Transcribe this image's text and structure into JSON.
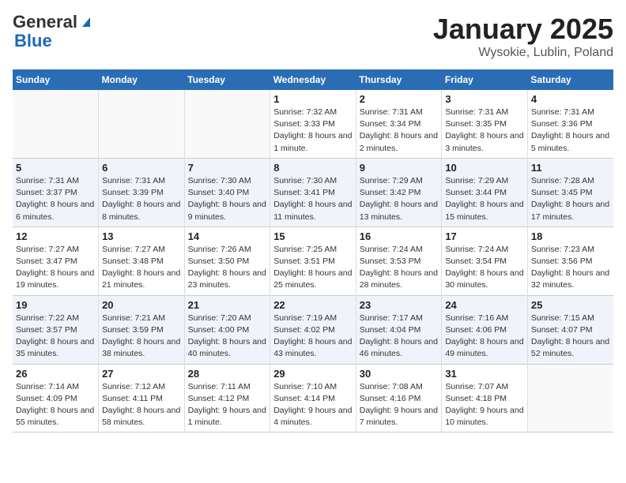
{
  "app": {
    "logo_general": "General",
    "logo_blue": "Blue",
    "title": "January 2025",
    "subtitle": "Wysokie, Lublin, Poland"
  },
  "calendar": {
    "headers": [
      "Sunday",
      "Monday",
      "Tuesday",
      "Wednesday",
      "Thursday",
      "Friday",
      "Saturday"
    ],
    "rows": [
      [
        {
          "day": "",
          "info": ""
        },
        {
          "day": "",
          "info": ""
        },
        {
          "day": "",
          "info": ""
        },
        {
          "day": "1",
          "info": "Sunrise: 7:32 AM\nSunset: 3:33 PM\nDaylight: 8 hours\nand 1 minute."
        },
        {
          "day": "2",
          "info": "Sunrise: 7:31 AM\nSunset: 3:34 PM\nDaylight: 8 hours\nand 2 minutes."
        },
        {
          "day": "3",
          "info": "Sunrise: 7:31 AM\nSunset: 3:35 PM\nDaylight: 8 hours\nand 3 minutes."
        },
        {
          "day": "4",
          "info": "Sunrise: 7:31 AM\nSunset: 3:36 PM\nDaylight: 8 hours\nand 5 minutes."
        }
      ],
      [
        {
          "day": "5",
          "info": "Sunrise: 7:31 AM\nSunset: 3:37 PM\nDaylight: 8 hours\nand 6 minutes."
        },
        {
          "day": "6",
          "info": "Sunrise: 7:31 AM\nSunset: 3:39 PM\nDaylight: 8 hours\nand 8 minutes."
        },
        {
          "day": "7",
          "info": "Sunrise: 7:30 AM\nSunset: 3:40 PM\nDaylight: 8 hours\nand 9 minutes."
        },
        {
          "day": "8",
          "info": "Sunrise: 7:30 AM\nSunset: 3:41 PM\nDaylight: 8 hours\nand 11 minutes."
        },
        {
          "day": "9",
          "info": "Sunrise: 7:29 AM\nSunset: 3:42 PM\nDaylight: 8 hours\nand 13 minutes."
        },
        {
          "day": "10",
          "info": "Sunrise: 7:29 AM\nSunset: 3:44 PM\nDaylight: 8 hours\nand 15 minutes."
        },
        {
          "day": "11",
          "info": "Sunrise: 7:28 AM\nSunset: 3:45 PM\nDaylight: 8 hours\nand 17 minutes."
        }
      ],
      [
        {
          "day": "12",
          "info": "Sunrise: 7:27 AM\nSunset: 3:47 PM\nDaylight: 8 hours\nand 19 minutes."
        },
        {
          "day": "13",
          "info": "Sunrise: 7:27 AM\nSunset: 3:48 PM\nDaylight: 8 hours\nand 21 minutes."
        },
        {
          "day": "14",
          "info": "Sunrise: 7:26 AM\nSunset: 3:50 PM\nDaylight: 8 hours\nand 23 minutes."
        },
        {
          "day": "15",
          "info": "Sunrise: 7:25 AM\nSunset: 3:51 PM\nDaylight: 8 hours\nand 25 minutes."
        },
        {
          "day": "16",
          "info": "Sunrise: 7:24 AM\nSunset: 3:53 PM\nDaylight: 8 hours\nand 28 minutes."
        },
        {
          "day": "17",
          "info": "Sunrise: 7:24 AM\nSunset: 3:54 PM\nDaylight: 8 hours\nand 30 minutes."
        },
        {
          "day": "18",
          "info": "Sunrise: 7:23 AM\nSunset: 3:56 PM\nDaylight: 8 hours\nand 32 minutes."
        }
      ],
      [
        {
          "day": "19",
          "info": "Sunrise: 7:22 AM\nSunset: 3:57 PM\nDaylight: 8 hours\nand 35 minutes."
        },
        {
          "day": "20",
          "info": "Sunrise: 7:21 AM\nSunset: 3:59 PM\nDaylight: 8 hours\nand 38 minutes."
        },
        {
          "day": "21",
          "info": "Sunrise: 7:20 AM\nSunset: 4:00 PM\nDaylight: 8 hours\nand 40 minutes."
        },
        {
          "day": "22",
          "info": "Sunrise: 7:19 AM\nSunset: 4:02 PM\nDaylight: 8 hours\nand 43 minutes."
        },
        {
          "day": "23",
          "info": "Sunrise: 7:17 AM\nSunset: 4:04 PM\nDaylight: 8 hours\nand 46 minutes."
        },
        {
          "day": "24",
          "info": "Sunrise: 7:16 AM\nSunset: 4:06 PM\nDaylight: 8 hours\nand 49 minutes."
        },
        {
          "day": "25",
          "info": "Sunrise: 7:15 AM\nSunset: 4:07 PM\nDaylight: 8 hours\nand 52 minutes."
        }
      ],
      [
        {
          "day": "26",
          "info": "Sunrise: 7:14 AM\nSunset: 4:09 PM\nDaylight: 8 hours\nand 55 minutes."
        },
        {
          "day": "27",
          "info": "Sunrise: 7:12 AM\nSunset: 4:11 PM\nDaylight: 8 hours\nand 58 minutes."
        },
        {
          "day": "28",
          "info": "Sunrise: 7:11 AM\nSunset: 4:12 PM\nDaylight: 9 hours\nand 1 minute."
        },
        {
          "day": "29",
          "info": "Sunrise: 7:10 AM\nSunset: 4:14 PM\nDaylight: 9 hours\nand 4 minutes."
        },
        {
          "day": "30",
          "info": "Sunrise: 7:08 AM\nSunset: 4:16 PM\nDaylight: 9 hours\nand 7 minutes."
        },
        {
          "day": "31",
          "info": "Sunrise: 7:07 AM\nSunset: 4:18 PM\nDaylight: 9 hours\nand 10 minutes."
        },
        {
          "day": "",
          "info": ""
        }
      ]
    ]
  }
}
